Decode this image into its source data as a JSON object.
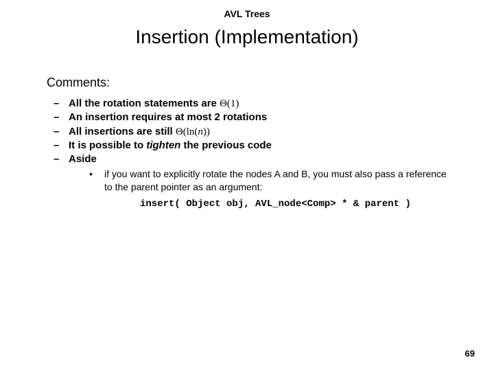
{
  "header": "AVL Trees",
  "title": "Insertion (Implementation)",
  "comments_label": "Comments:",
  "bullets": {
    "b1_pre": "All the rotation statements are ",
    "b1_theta": "Θ(1)",
    "b2": "An insertion requires at most 2 rotations",
    "b3_pre": "All insertions are still ",
    "b3_theta_open": "Θ(ln(",
    "b3_n": "n",
    "b3_theta_close": "))",
    "b4_pre": "It is possible to ",
    "b4_em": "tighten",
    "b4_post": " the previous code",
    "b5": "Aside"
  },
  "sub": {
    "text": "if you want to explicitly rotate the nodes A and B, you must also pass a reference to the parent pointer as an argument:"
  },
  "code": "insert( Object obj, AVL_node<Comp> * & parent )",
  "page": "69"
}
